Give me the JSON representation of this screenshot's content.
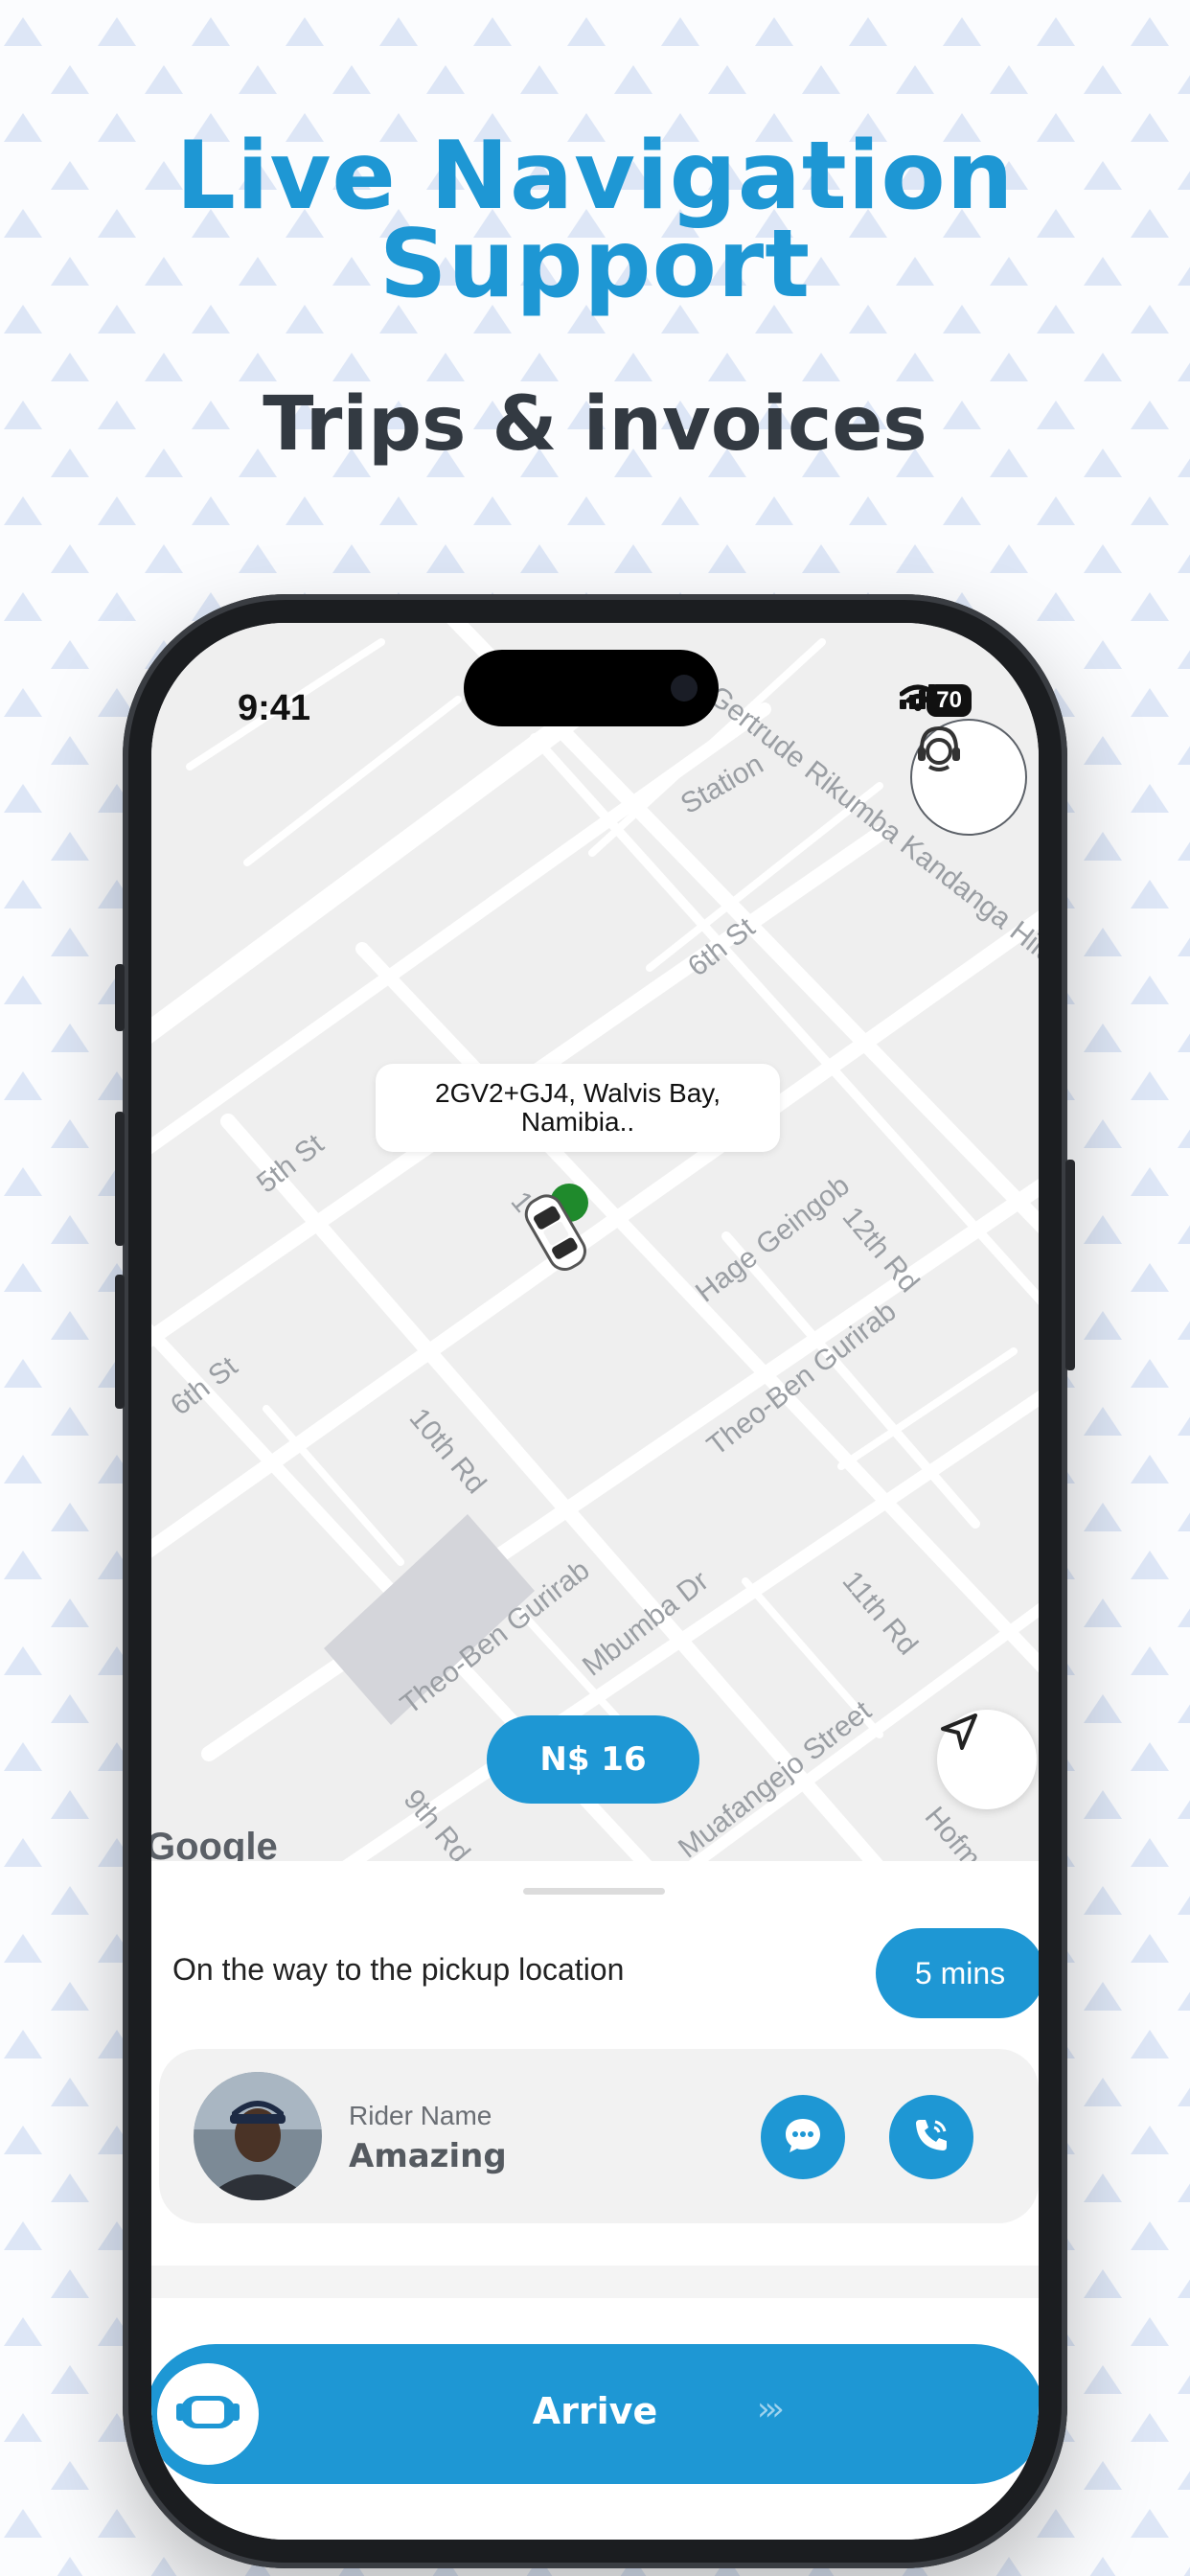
{
  "promo": {
    "headline": "Live Navigation Support",
    "subheadline": "Trips & invoices"
  },
  "status_bar": {
    "time": "9:41",
    "battery": "70"
  },
  "map": {
    "pickup_address": "2GV2+GJ4, Walvis Bay, Namibia..",
    "fare": "N$ 16",
    "attribution": "Google",
    "street_labels": [
      "Station",
      "Gertrude Rikumba Kandanga Hilukilwa",
      "6th St",
      "5th St",
      "12th Rd",
      "Hage Geingob",
      "6th St",
      "Theo-Ben Gurirab",
      "10th Rd",
      "Theo-Ben Gurirab",
      "11th Rd",
      "Mbumba Dr",
      "Muafangejo Street",
      "9th Rd",
      "Hofm",
      "1"
    ]
  },
  "trip": {
    "status": "On the way to the pickup location",
    "eta": "5 mins"
  },
  "rider": {
    "label": "Rider Name",
    "name": "Amazing"
  },
  "action": {
    "arrive_label": "Arrive"
  },
  "colors": {
    "brand_blue": "#1e97d4",
    "heading_dark": "#333a42"
  },
  "icons": [
    "support-agent-icon",
    "navigation-arrow-icon",
    "car-icon",
    "chat-icon",
    "phone-icon",
    "slider-car-icon",
    "chevrons-right-icon",
    "signal-icon",
    "wifi-icon"
  ]
}
